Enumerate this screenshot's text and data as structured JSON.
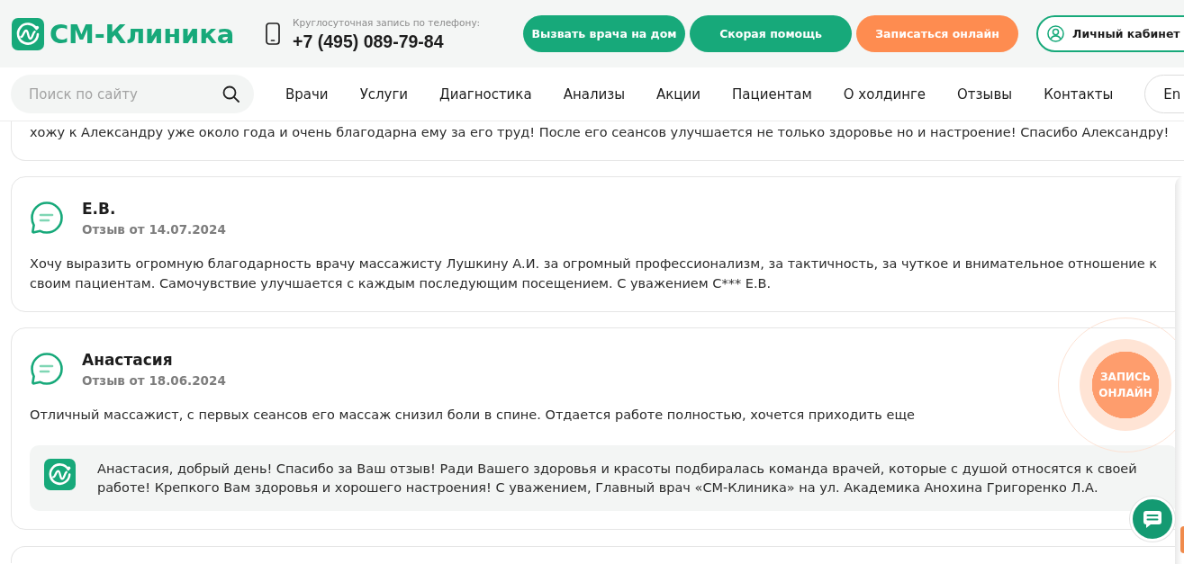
{
  "header": {
    "logo": {
      "text": "СМ-Клиника"
    },
    "phone": {
      "caption": "Круглосуточная запись по телефону:",
      "number": "+7 (495) 089-79-84"
    },
    "buttons": [
      {
        "label": "Вызвать врача на дом",
        "kind": "primary"
      },
      {
        "label": "Скорая помощь",
        "kind": "primary"
      },
      {
        "label": "Записаться онлайн",
        "kind": "accent"
      },
      {
        "label": "Личный кабинет",
        "kind": "account"
      }
    ]
  },
  "nav": {
    "search": {
      "placeholder": "Поиск по сайту"
    },
    "items": [
      "Врачи",
      "Услуги",
      "Диагностика",
      "Анализы",
      "Акции",
      "Пациентам",
      "О холдинге",
      "Отзывы",
      "Контакты"
    ],
    "language": "En"
  },
  "reviews": [
    {
      "kind": "cut_top",
      "text": "хожу к Александру уже около года и очень благодарна ему за его труд! После его сеансов улучшается не только здоровье но и настроение! Спасибо Александру!"
    },
    {
      "kind": "full",
      "author": "Е.В.",
      "date": "Отзыв от 14.07.2024",
      "text": "Хочу выразить огромную благодарность врачу массажисту Лушкину А.И. за огромный профессионализм, за тактичность, за чуткое и внимательное отношение к своим пациентам. Самочувствие улучшается с каждым последующим посещением. С уважением С*** Е.В."
    },
    {
      "kind": "full",
      "author": "Анастасия",
      "date": "Отзыв от 18.06.2024",
      "text": "Отличный массажист, с первых сеансов его массаж снизил боли в спине. Отдается работе полностью, хочется приходить еще",
      "reply": {
        "text": "Анастасия, добрый день! Спасибо за Ваш отзыв! Ради Вашего здоровья и красоты подбиралась команда врачей, которые с душой относятся к своей работе! Крепкого Вам здоровья и хорошего настроения! С уважением, Главный врач «СМ-Клиника» на ул. Академика Анохина Григоренко Л.А."
      }
    },
    {
      "kind": "cut_bottom"
    }
  ],
  "floating": {
    "booking_button": "ЗАПИСЬ ОНЛАЙН"
  }
}
